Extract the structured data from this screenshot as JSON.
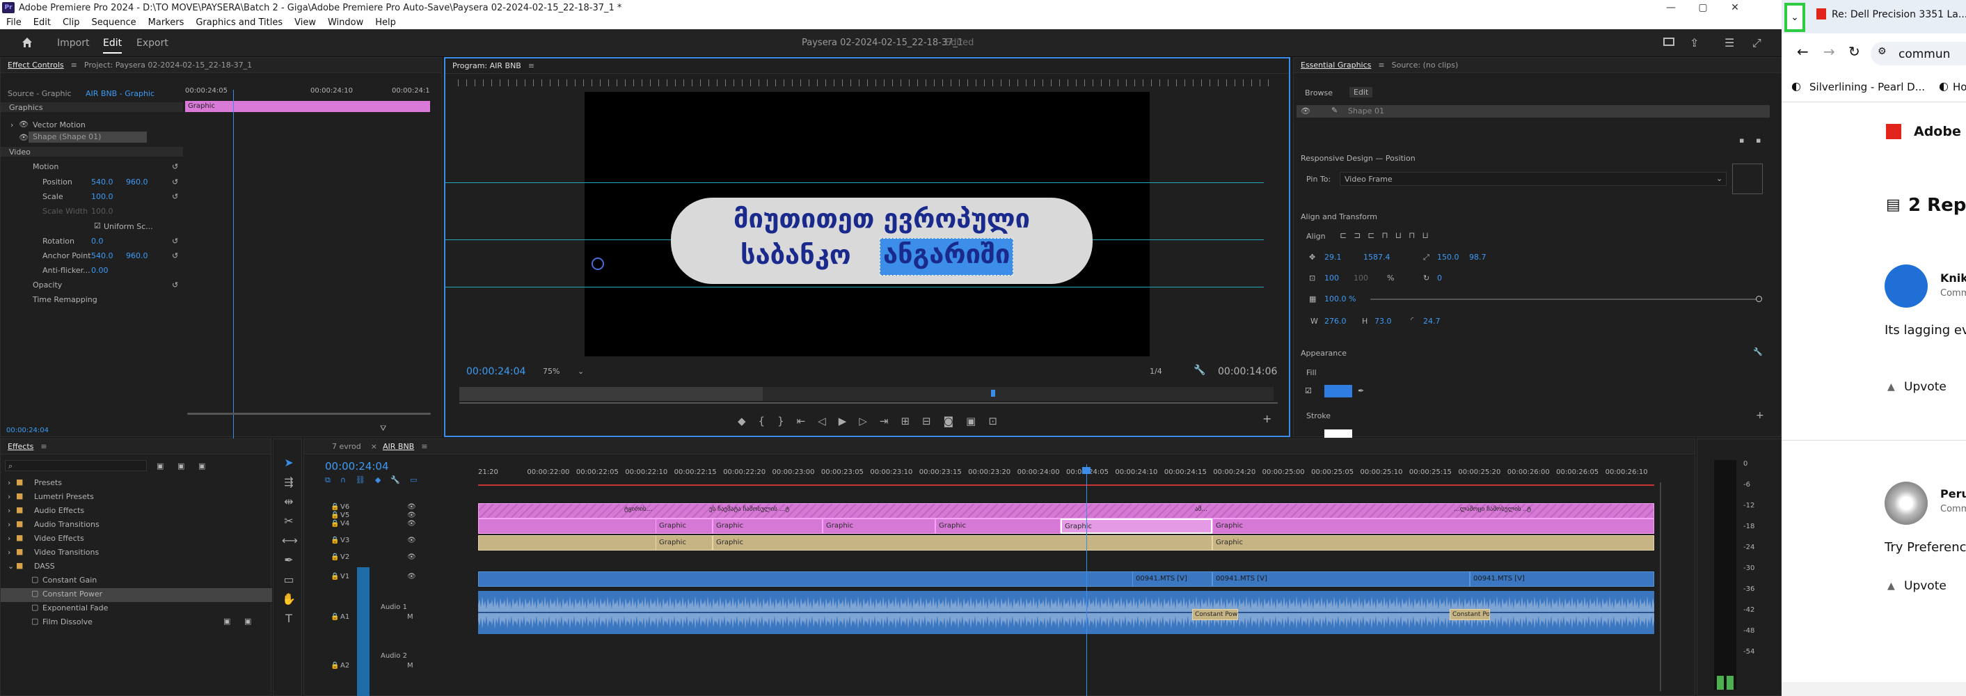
{
  "window": {
    "title": "Adobe Premiere Pro 2024 - D:\\TO MOVE\\PAYSERA\\Batch 2 - Giga\\Adobe Premiere Pro Auto-Save\\Paysera 02-2024-02-15_22-18-37_1 *"
  },
  "menu": [
    "File",
    "Edit",
    "Clip",
    "Sequence",
    "Markers",
    "Graphics and Titles",
    "View",
    "Window",
    "Help"
  ],
  "workspace": {
    "tabs": [
      "Import",
      "Edit",
      "Export"
    ],
    "active": "Edit",
    "project_name": "Paysera 02-2024-02-15_22-18-37_1",
    "status": "Edited"
  },
  "effect_controls": {
    "tab": "Effect Controls",
    "tab2": "Project: Paysera 02-2024-02-15_22-18-37_1",
    "source": "Source - Graphic",
    "seq": "AIR BNB - Graphic",
    "tc1": "00:00:24:05",
    "tc2": "00:00:24:10",
    "tc3": "00:00:24:1",
    "clip_label": "Graphic",
    "section_graphics": "Graphics",
    "vector_motion": "Vector Motion",
    "shape": "Shape (Shape 01)",
    "section_video": "Video",
    "motion": "Motion",
    "position_label": "Position",
    "pos_x": "540.0",
    "pos_y": "960.0",
    "scale_label": "Scale",
    "scale": "100.0",
    "scale_width_label": "Scale Width",
    "scale_width": "100.0",
    "uniform": "Uniform Sc...",
    "rotation_label": "Rotation",
    "rotation": "0.0",
    "anchor_label": "Anchor Point",
    "anchor_x": "540.0",
    "anchor_y": "960.0",
    "antiflicker_label": "Anti-flicker...",
    "antiflicker": "0.00",
    "opacity": "Opacity",
    "time_remap": "Time Remapping",
    "timecode": "00:00:24:04"
  },
  "program": {
    "tab": "Program: AIR BNB",
    "line1": "მიუთითეთ ევროპული",
    "line2a": "საბანკო",
    "line2b": "ანგარიში",
    "timecode": "00:00:24:04",
    "zoom": "75%",
    "quality": "1/4",
    "duration": "00:00:14:06"
  },
  "essential": {
    "tab": "Essential Graphics",
    "tab2": "Source: (no clips)",
    "browse": "Browse",
    "edit": "Edit",
    "layer": "Shape 01",
    "responsive": "Responsive Design — Position",
    "pin_to": "Pin To:",
    "pin_value": "Video Frame",
    "align_transform": "Align and Transform",
    "align": "Align",
    "pos_x": "29.1",
    "pos_y": "1587.4",
    "anchor_x": "150.0",
    "anchor_y": "98.7",
    "scale_x": "100",
    "scale_y": "100",
    "pct": "%",
    "rotation": "0",
    "opacity": "100.0 %",
    "w_label": "W",
    "w": "276.0",
    "h_label": "H",
    "h": "73.0",
    "radius": "24.7",
    "appearance": "Appearance",
    "fill": "Fill",
    "fill_color": "#2f7de1",
    "stroke": "Stroke"
  },
  "effects": {
    "tab": "Effects",
    "items": [
      "Presets",
      "Lumetri Presets",
      "Audio Effects",
      "Audio Transitions",
      "Video Effects",
      "Video Transitions",
      "DASS"
    ],
    "sub": [
      "Constant Gain",
      "Constant Power",
      "Exponential Fade",
      "Film Dissolve"
    ]
  },
  "timeline": {
    "tab1": "7 evrod",
    "tab2": "AIR BNB",
    "timecode": "00:00:24:04",
    "ruler": [
      "21:20",
      "00:00:22:00",
      "00:00:22:05",
      "00:00:22:10",
      "00:00:22:15",
      "00:00:22:20",
      "00:00:23:00",
      "00:00:23:05",
      "00:00:23:10",
      "00:00:23:15",
      "00:00:23:20",
      "00:00:24:00",
      "00:00:24:05",
      "00:00:24:10",
      "00:00:24:15",
      "00:00:24:20",
      "00:00:25:00",
      "00:00:25:05",
      "00:00:25:10",
      "00:00:25:15",
      "00:00:25:20",
      "00:00:26:00",
      "00:00:26:05",
      "00:00:26:10"
    ],
    "tracks": [
      "V6",
      "V5",
      "V4",
      "V3",
      "V2",
      "V1",
      "A1",
      "A2"
    ],
    "audio1": "Audio 1",
    "audio2": "Audio 2",
    "clip_graphic": "Graphic",
    "clip_mts": "00941.MTS [V]",
    "transition": "Constant Power",
    "v6_clips": [
      "ტყირის...",
      "ეს ჩაემატა ჩამოსულის ...ტ",
      "ამ...",
      "...ლამოცი ჩამოსულის ..ტ"
    ],
    "meter": [
      "0",
      "-6",
      "-12",
      "-18",
      "-24",
      "-30",
      "-36",
      "-42",
      "-48",
      "-54"
    ]
  },
  "browser": {
    "tab_title": "Re: Dell Precision 3351 La...",
    "address": "commun",
    "bookmark1": "Silverlining - Pearl D...",
    "bookmark2": "Hous",
    "brand": "Adobe",
    "replies": "2 Rep",
    "user1": "Knik",
    "user1_sub": "Comm",
    "comment1": "Its lagging eve",
    "upvote": "Upvote",
    "user2": "Peru",
    "user2_sub": "Comm",
    "comment2": "Try Preferenc"
  }
}
